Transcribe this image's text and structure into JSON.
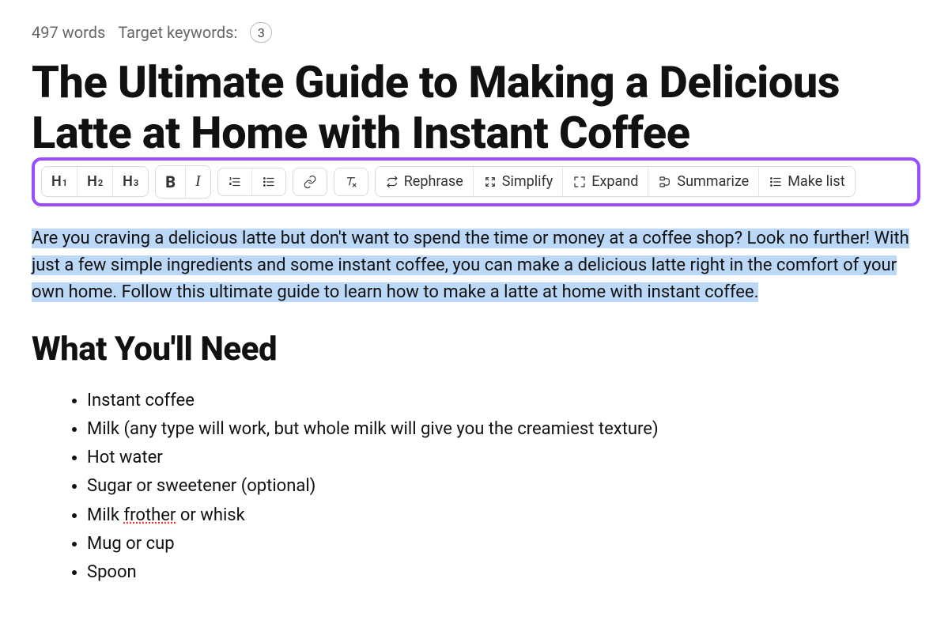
{
  "meta": {
    "word_count": "497 words",
    "keywords_label": "Target keywords:",
    "keywords_count": "3"
  },
  "title": "The Ultimate Guide to Making a Delicious Latte at Home with Instant Coffee",
  "toolbar": {
    "h1": "H",
    "h1_sub": "1",
    "h2": "H",
    "h2_sub": "2",
    "h3": "H",
    "h3_sub": "3",
    "bold": "B",
    "italic": "I",
    "rephrase": "Rephrase",
    "simplify": "Simplify",
    "expand": "Expand",
    "summarize": "Summarize",
    "make_list": "Make list"
  },
  "intro": "Are you craving a delicious latte but don't want to spend the time or money at a coffee shop? Look no further! With just a few simple ingredients and some instant coffee, you can make a delicious latte right in the comfort of your own home. Follow this ultimate guide to learn how to make a latte at home with instant coffee.",
  "section1": {
    "heading": "What You'll Need",
    "items": {
      "i0": "Instant coffee",
      "i1": "Milk (any type will work, but whole milk will give you the creamiest texture)",
      "i2": "Hot water",
      "i3": "Sugar or sweetener (optional)",
      "i4_pre": "Milk ",
      "i4_err": "frother",
      "i4_post": " or whisk",
      "i5": "Mug or cup",
      "i6": "Spoon"
    }
  }
}
